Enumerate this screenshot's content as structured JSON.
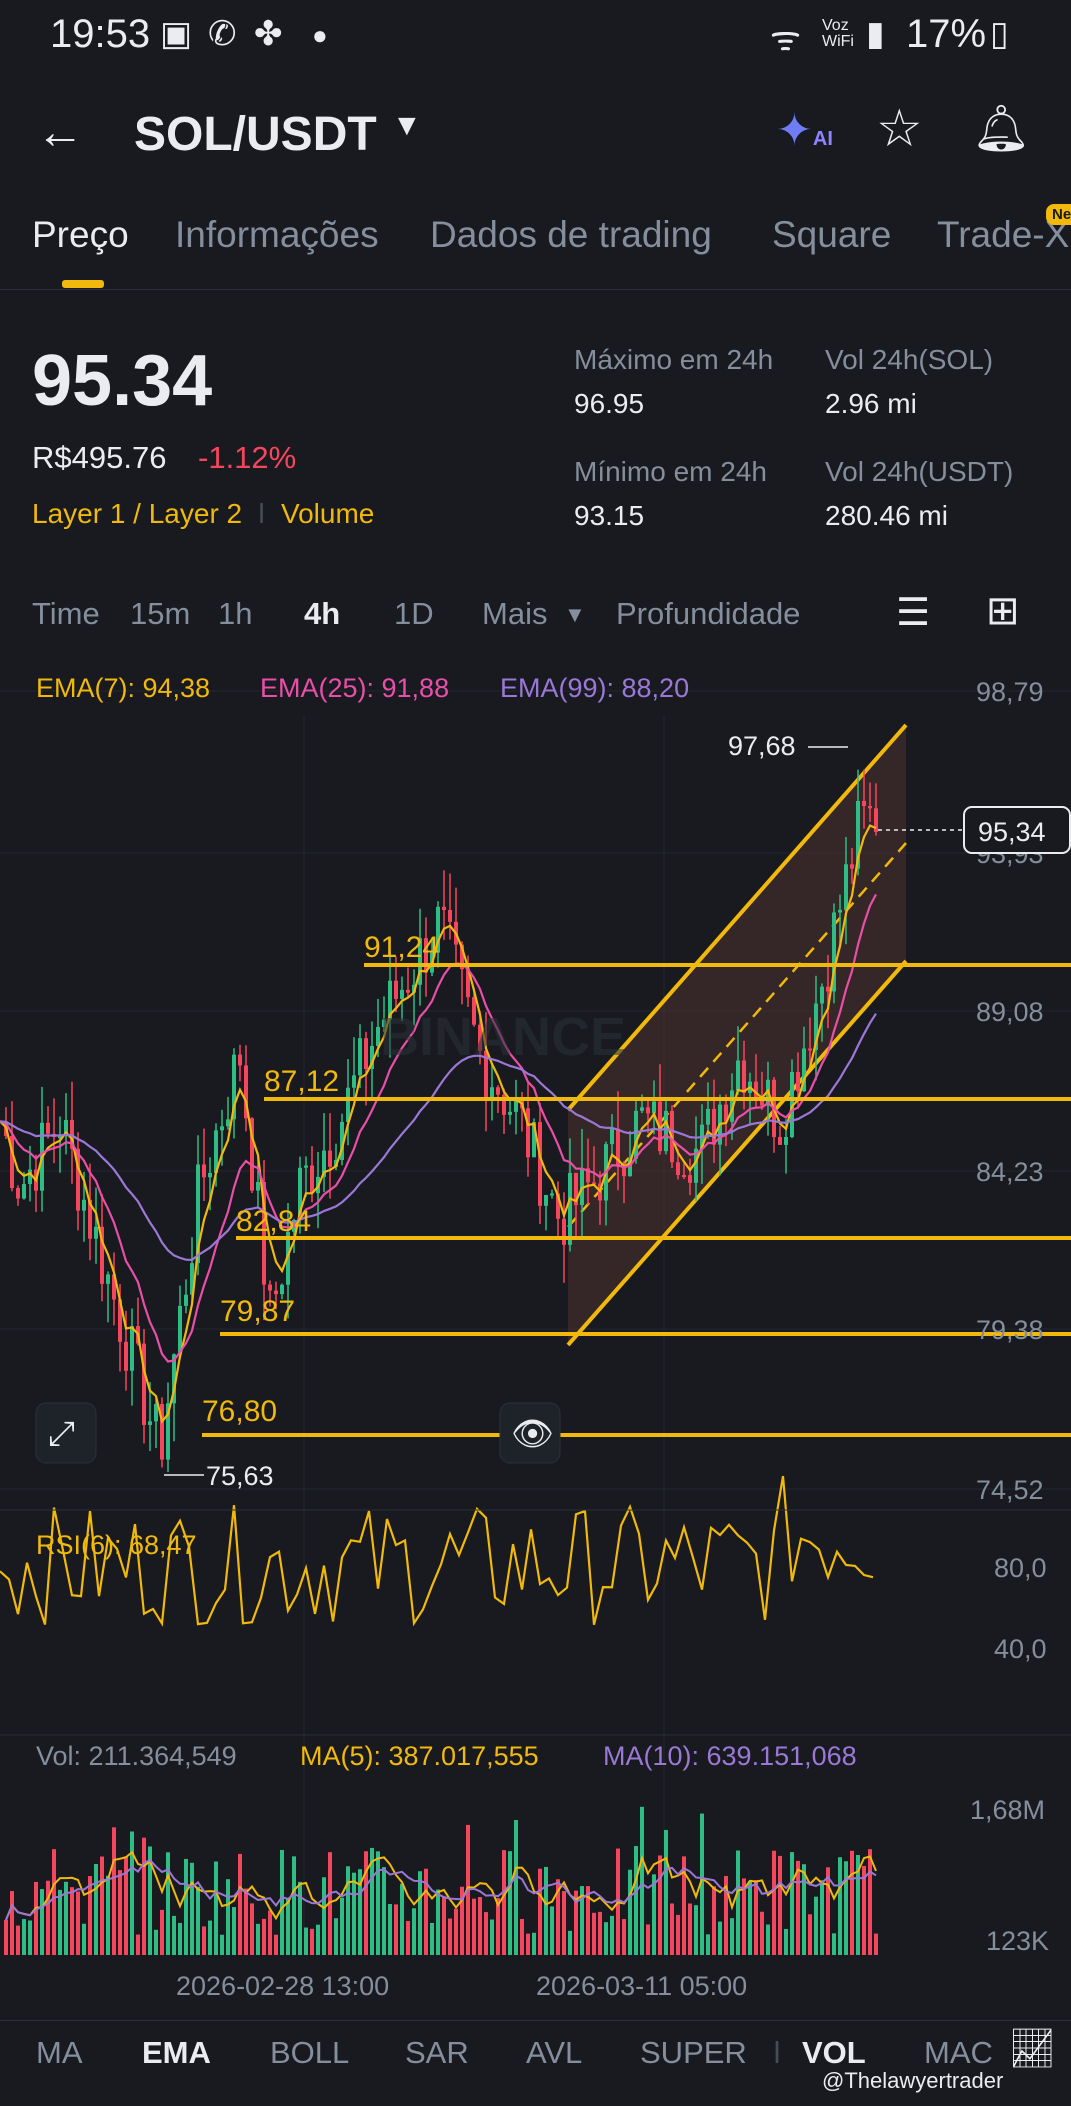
{
  "status_bar": {
    "time": "19:53",
    "network_label": "Voz WiFi",
    "battery": "17%"
  },
  "header": {
    "pair": "SOL/USDT",
    "ai_label": "AI"
  },
  "tabs": [
    "Preço",
    "Informações",
    "Dados de trading",
    "Square",
    "Trade-X"
  ],
  "new_badge": "New",
  "ticker": {
    "price": "95.34",
    "fiat": "R$495.76",
    "change": "-1.12%",
    "tag_layer": "Layer 1 / Layer 2",
    "tag_volume": "Volume",
    "high_label": "Máximo em 24h",
    "high_value": "96.95",
    "low_label": "Mínimo em 24h",
    "low_value": "93.15",
    "vol_sol_label": "Vol 24h(SOL)",
    "vol_sol_value": "2.96 mi",
    "vol_usdt_label": "Vol 24h(USDT)",
    "vol_usdt_value": "280.46 mi"
  },
  "intervals": [
    "Time",
    "15m",
    "1h",
    "4h",
    "1D",
    "Mais",
    "Profundidade"
  ],
  "active_interval": "4h",
  "chart": {
    "ema_labels": [
      "EMA(7): 94,38",
      "EMA(25): 91,88",
      "EMA(99): 88,20"
    ],
    "price_axis": [
      "98,79",
      "93,93",
      "89,08",
      "84,23",
      "79,38",
      "74,52"
    ],
    "current_price_label": "95,34",
    "high_marker": "97,68",
    "low_marker": "75,63",
    "levels": [
      "91,24",
      "87,12",
      "82,84",
      "79,87",
      "76,80"
    ],
    "watermark": "BINANCE",
    "rsi_label": "RSI(6): 68,47",
    "rsi_axis": [
      "80,0",
      "40,0"
    ],
    "vol_labels": [
      "Vol: 211.364,549",
      "MA(5): 387.017,555",
      "MA(10): 639.151,068"
    ],
    "vol_axis": [
      "1,68M",
      "123K"
    ],
    "time_labels": [
      "2026-02-28 13:00",
      "2026-03-11 05:00"
    ],
    "colors": {
      "up": "#2ebd85",
      "down": "#f6465d",
      "ema7": "#f0b90b",
      "ema25": "#e84fa8",
      "ema99": "#9b78d6",
      "lines": "#f0b90b"
    }
  },
  "indicators": [
    "MA",
    "EMA",
    "BOLL",
    "SAR",
    "AVL",
    "SUPER",
    "VOL",
    "MAC"
  ],
  "attribution": "@Thelawyertrader"
}
